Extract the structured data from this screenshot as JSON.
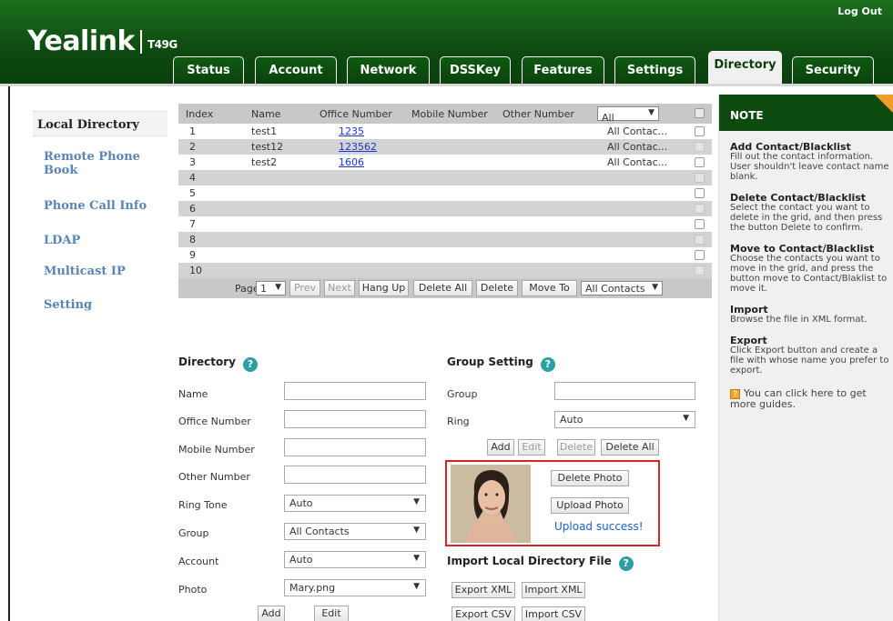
{
  "header": {
    "logo": "Yealink",
    "model": "T49G",
    "logout": "Log Out",
    "tabs": [
      "Status",
      "Account",
      "Network",
      "DSSKey",
      "Features",
      "Settings",
      "Directory",
      "Security"
    ],
    "active_tab": "Directory"
  },
  "sidebar": {
    "items": [
      "Local Directory",
      "Remote Phone Book",
      "Phone Call Info",
      "LDAP",
      "Multicast IP",
      "Setting"
    ],
    "active": "Local Directory"
  },
  "grid": {
    "columns": [
      "Index",
      "Name",
      "Office Number",
      "Mobile Number",
      "Other Number"
    ],
    "filter": "All Contacts",
    "rows": [
      {
        "index": "1",
        "name": "test1",
        "office": "1235",
        "group": "All Contac..."
      },
      {
        "index": "2",
        "name": "test12",
        "office": "123562",
        "group": "All Contac..."
      },
      {
        "index": "3",
        "name": "test2",
        "office": "1606",
        "group": "All Contac..."
      },
      {
        "index": "4",
        "name": "",
        "office": "",
        "group": ""
      },
      {
        "index": "5",
        "name": "",
        "office": "",
        "group": ""
      },
      {
        "index": "6",
        "name": "",
        "office": "",
        "group": ""
      },
      {
        "index": "7",
        "name": "",
        "office": "",
        "group": ""
      },
      {
        "index": "8",
        "name": "",
        "office": "",
        "group": ""
      },
      {
        "index": "9",
        "name": "",
        "office": "",
        "group": ""
      },
      {
        "index": "10",
        "name": "",
        "office": "",
        "group": ""
      }
    ],
    "pager": {
      "page_label": "Page",
      "page_value": "1",
      "prev": "Prev",
      "next": "Next",
      "hang_up": "Hang Up",
      "delete_all": "Delete All",
      "delete": "Delete",
      "move_to": "Move To",
      "move_target": "All Contacts"
    }
  },
  "directory_form": {
    "title": "Directory",
    "name_label": "Name",
    "office_label": "Office Number",
    "mobile_label": "Mobile Number",
    "other_label": "Other Number",
    "ring_tone_label": "Ring Tone",
    "ring_tone_value": "Auto",
    "group_label": "Group",
    "group_value": "All Contacts",
    "account_label": "Account",
    "account_value": "Auto",
    "photo_label": "Photo",
    "photo_value": "Mary.png",
    "add": "Add",
    "edit": "Edit"
  },
  "group_setting": {
    "title": "Group Setting",
    "group_label": "Group",
    "ring_label": "Ring",
    "ring_value": "Auto",
    "add": "Add",
    "edit": "Edit",
    "delete": "Delete",
    "delete_all": "Delete All",
    "delete_photo": "Delete Photo",
    "upload_photo": "Upload Photo",
    "upload_status": "Upload success!"
  },
  "import_section": {
    "title": "Import Local Directory File",
    "export_xml": "Export XML",
    "import_xml": "Import XML",
    "export_csv": "Export CSV",
    "import_csv": "Import CSV"
  },
  "note": {
    "title": "NOTE",
    "sections": [
      {
        "title": "Add Contact/Blacklist",
        "text": "Fill out the contact information. User shouldn't leave contact name blank."
      },
      {
        "title": "Delete Contact/Blacklist",
        "text": "Select the contact you want to delete in the grid, and then press the button Delete to confirm."
      },
      {
        "title": "Move to Contact/Blacklist",
        "text": "Choose the contacts you want to move in the grid, and press the button move to Contact/Blaklist to move it."
      },
      {
        "title": "Import",
        "text": "Browse the file in XML format."
      },
      {
        "title": "Export",
        "text": "Click Export button and create a file with whose name you prefer to export."
      }
    ],
    "tip": "You can click here to get more guides."
  }
}
